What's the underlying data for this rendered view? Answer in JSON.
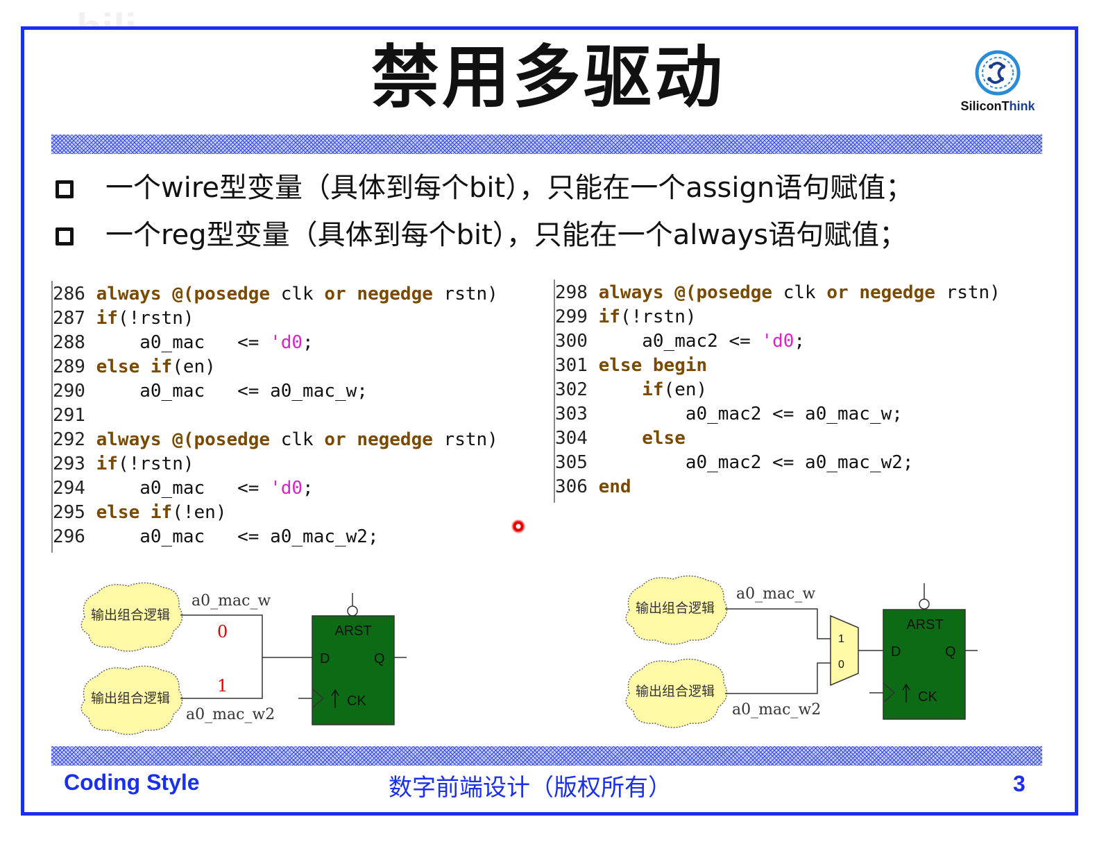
{
  "title": "禁用多驱动",
  "logo": {
    "text_main": "SiliconT",
    "text_accent": "hink"
  },
  "bullets": [
    "一个wire型变量（具体到每个bit），只能在一个assign语句赋值；",
    "一个reg型变量（具体到每个bit），只能在一个always语句赋值；"
  ],
  "code_left": [
    [
      {
        "t": "286 ",
        "c": "ln"
      },
      {
        "t": "always @(posedge",
        "c": "kw"
      },
      {
        "t": " clk ",
        "c": "id"
      },
      {
        "t": "or negedge",
        "c": "kw"
      },
      {
        "t": " rstn)",
        "c": "id"
      }
    ],
    [
      {
        "t": "287 ",
        "c": "ln"
      },
      {
        "t": "if",
        "c": "kw"
      },
      {
        "t": "(!rstn)",
        "c": "id"
      }
    ],
    [
      {
        "t": "288 ",
        "c": "ln"
      },
      {
        "t": "    a0_mac   <= ",
        "c": "id"
      },
      {
        "t": "'d0",
        "c": "num"
      },
      {
        "t": ";",
        "c": "id"
      }
    ],
    [
      {
        "t": "289 ",
        "c": "ln"
      },
      {
        "t": "else if",
        "c": "kw"
      },
      {
        "t": "(en)",
        "c": "id"
      }
    ],
    [
      {
        "t": "290 ",
        "c": "ln"
      },
      {
        "t": "    a0_mac   <= a0_mac_w;",
        "c": "id"
      }
    ],
    [
      {
        "t": "291",
        "c": "ln"
      }
    ],
    [
      {
        "t": "292 ",
        "c": "ln"
      },
      {
        "t": "always @(posedge",
        "c": "kw"
      },
      {
        "t": " clk ",
        "c": "id"
      },
      {
        "t": "or negedge",
        "c": "kw"
      },
      {
        "t": " rstn)",
        "c": "id"
      }
    ],
    [
      {
        "t": "293 ",
        "c": "ln"
      },
      {
        "t": "if",
        "c": "kw"
      },
      {
        "t": "(!rstn)",
        "c": "id"
      }
    ],
    [
      {
        "t": "294 ",
        "c": "ln"
      },
      {
        "t": "    a0_mac   <= ",
        "c": "id"
      },
      {
        "t": "'d0",
        "c": "num"
      },
      {
        "t": ";",
        "c": "id"
      }
    ],
    [
      {
        "t": "295 ",
        "c": "ln"
      },
      {
        "t": "else if",
        "c": "kw"
      },
      {
        "t": "(!en)",
        "c": "id"
      }
    ],
    [
      {
        "t": "296 ",
        "c": "ln"
      },
      {
        "t": "    a0_mac   <= a0_mac_w2;",
        "c": "id"
      }
    ]
  ],
  "code_right": [
    [
      {
        "t": "298 ",
        "c": "ln"
      },
      {
        "t": "always @(posedge",
        "c": "kw"
      },
      {
        "t": " clk ",
        "c": "id"
      },
      {
        "t": "or negedge",
        "c": "kw"
      },
      {
        "t": " rstn)",
        "c": "id"
      }
    ],
    [
      {
        "t": "299 ",
        "c": "ln"
      },
      {
        "t": "if",
        "c": "kw"
      },
      {
        "t": "(!rstn)",
        "c": "id"
      }
    ],
    [
      {
        "t": "300 ",
        "c": "ln"
      },
      {
        "t": "    a0_mac2 <= ",
        "c": "id"
      },
      {
        "t": "'d0",
        "c": "num"
      },
      {
        "t": ";",
        "c": "id"
      }
    ],
    [
      {
        "t": "301 ",
        "c": "ln"
      },
      {
        "t": "else begin",
        "c": "kw"
      }
    ],
    [
      {
        "t": "302 ",
        "c": "ln"
      },
      {
        "t": "    if",
        "c": "kw"
      },
      {
        "t": "(en)",
        "c": "id"
      }
    ],
    [
      {
        "t": "303 ",
        "c": "ln"
      },
      {
        "t": "        a0_mac2 <= a0_mac_w;",
        "c": "id"
      }
    ],
    [
      {
        "t": "304 ",
        "c": "ln"
      },
      {
        "t": "    else",
        "c": "kw"
      }
    ],
    [
      {
        "t": "305 ",
        "c": "ln"
      },
      {
        "t": "        a0_mac2 <= a0_mac_w2;",
        "c": "id"
      }
    ],
    [
      {
        "t": "306 ",
        "c": "ln"
      },
      {
        "t": "end",
        "c": "kw"
      }
    ]
  ],
  "diagram_left": {
    "cloud_label": "输出组合逻辑",
    "wire_top": "a0_mac_w",
    "wire_bottom": "a0_mac_w2",
    "val_top": "0",
    "val_bottom": "1",
    "ff_arst": "ARST",
    "ff_d": "D",
    "ff_q": "Q",
    "ff_ck": "CK"
  },
  "diagram_right": {
    "cloud_label": "输出组合逻辑",
    "wire_top": "a0_mac_w",
    "wire_bottom": "a0_mac_w2",
    "mux_1": "1",
    "mux_0": "0",
    "ff_arst": "ARST",
    "ff_d": "D",
    "ff_q": "Q",
    "ff_ck": "CK"
  },
  "footer": {
    "left": "Coding Style",
    "mid": "数字前端设计（版权所有）",
    "page": "3"
  },
  "colors": {
    "frame": "#1a2ff0",
    "ff_fill": "#0d6b16",
    "cloud_fill": "#fff9a8",
    "keyword": "#7a4a00",
    "literal": "#e020c8"
  }
}
